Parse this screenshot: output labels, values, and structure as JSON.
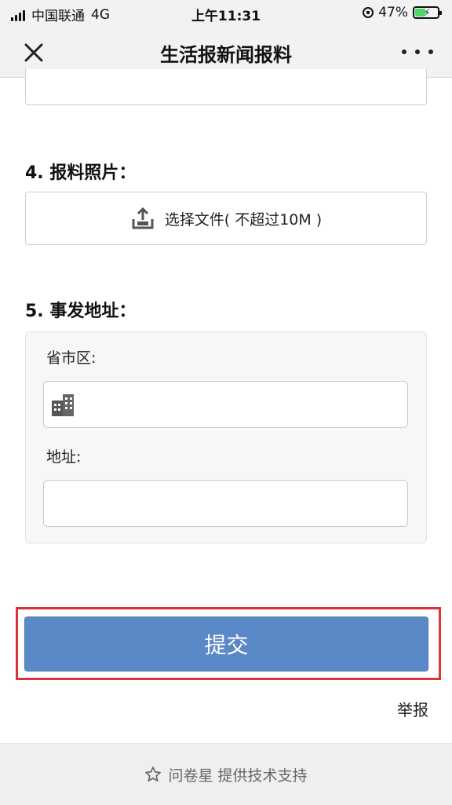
{
  "status_bar": {
    "carrier": "中国联通",
    "network": "4G",
    "time": "上午11:31",
    "battery_percent": "47%",
    "battery_level": 0.47
  },
  "nav": {
    "title": "生活报新闻报料"
  },
  "questions": {
    "photos": {
      "label": "4. 报料照片：",
      "upload_label": "选择文件( 不超过10M )"
    },
    "address": {
      "label": "5. 事发地址：",
      "region_label": "省市区:",
      "region_value": "",
      "detail_label": "地址:",
      "detail_value": ""
    }
  },
  "submit_label": "提交",
  "report_label": "举报",
  "footer_text": "问卷星 提供技术支持",
  "colors": {
    "submit": "#5b88c6",
    "highlight": "#d8343a"
  }
}
